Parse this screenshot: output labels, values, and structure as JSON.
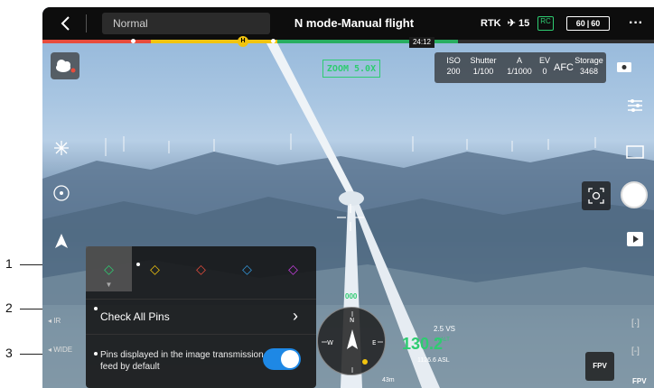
{
  "topbar": {
    "mode_dropdown": "Normal",
    "title": "N mode-Manual flight",
    "rtk_label": "RTK",
    "satellite_count": "15",
    "rc_label": "RC",
    "battery_1": "60",
    "battery_2": "60",
    "flight_time": "24:12",
    "home_marker": "H"
  },
  "camera": {
    "zoom": "ZOOM 5.0X",
    "iso_label": "ISO",
    "iso": "200",
    "shutter_label": "Shutter",
    "shutter": "1/100",
    "aperture_label": "A",
    "aperture": "1/1000",
    "ev_label": "EV",
    "ev": "0",
    "focus_mode": "AFC",
    "storage_label": "Storage",
    "storage": "3468"
  },
  "left_labels": {
    "ir": "IR",
    "wide": "WIDE"
  },
  "pins_panel": {
    "pins": [
      {
        "color": "#2ecc71",
        "selected": true
      },
      {
        "color": "#f1c40f",
        "selected": false
      },
      {
        "color": "#e74c3c",
        "selected": false
      },
      {
        "color": "#3498db",
        "selected": false
      },
      {
        "color": "#c740e0",
        "selected": false
      }
    ],
    "check_all_label": "Check All Pins",
    "pins_default_text": "Pins displayed in the image transmission feed by default",
    "toggle_on": true
  },
  "telemetry": {
    "heading": "000",
    "vs": "2.5 VS",
    "altitude": "130.2",
    "altitude_unit": "m ALT",
    "asl": "1126.6 ASL",
    "distance": "43m"
  },
  "fpv": {
    "button": "FPV",
    "label": "FPV"
  },
  "callouts": {
    "c1": "1",
    "c2": "2",
    "c3": "3"
  }
}
